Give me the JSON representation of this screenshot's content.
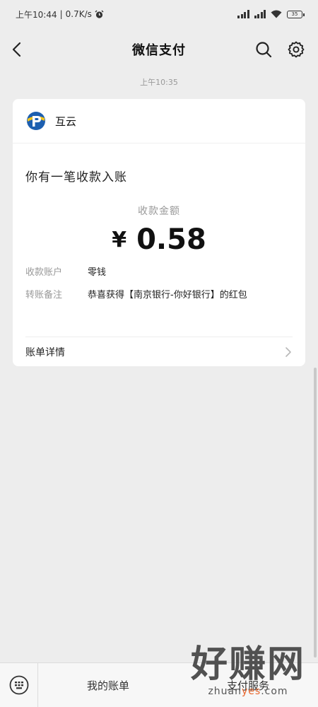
{
  "status_bar": {
    "time": "上午10:44",
    "speed": "0.7K/s",
    "battery": "35"
  },
  "nav": {
    "title": "微信支付"
  },
  "timestamp": "上午10:35",
  "card": {
    "merchant_name": "互云",
    "headline": "你有一笔收款入账",
    "amount_label": "收款金额",
    "currency": "¥",
    "amount": "0.58",
    "rows": [
      {
        "key": "收款账户",
        "value": "零钱"
      },
      {
        "key": "转账备注",
        "value": "恭喜获得【南京银行-你好银行】的红包"
      }
    ],
    "details_label": "账单详情"
  },
  "bottom_bar": {
    "menu_1": "我的账单",
    "menu_2": "支付服务"
  },
  "watermark": {
    "main": "好赚网",
    "sub_pre": "zhuan",
    "sub_hl": "yes",
    "sub_post": ".com"
  },
  "colors": {
    "background": "#ededed",
    "card": "#ffffff",
    "logo_blue": "#1d5fb0",
    "logo_yellow": "#f2c21b",
    "watermark_accent": "#e8652b"
  },
  "icons": {
    "back": "chevron-left-icon",
    "search": "search-icon",
    "settings": "gear-icon",
    "details": "chevron-right-icon",
    "keyboard": "keyboard-icon",
    "alarm": "alarm-icon",
    "wifi": "wifi-icon"
  }
}
